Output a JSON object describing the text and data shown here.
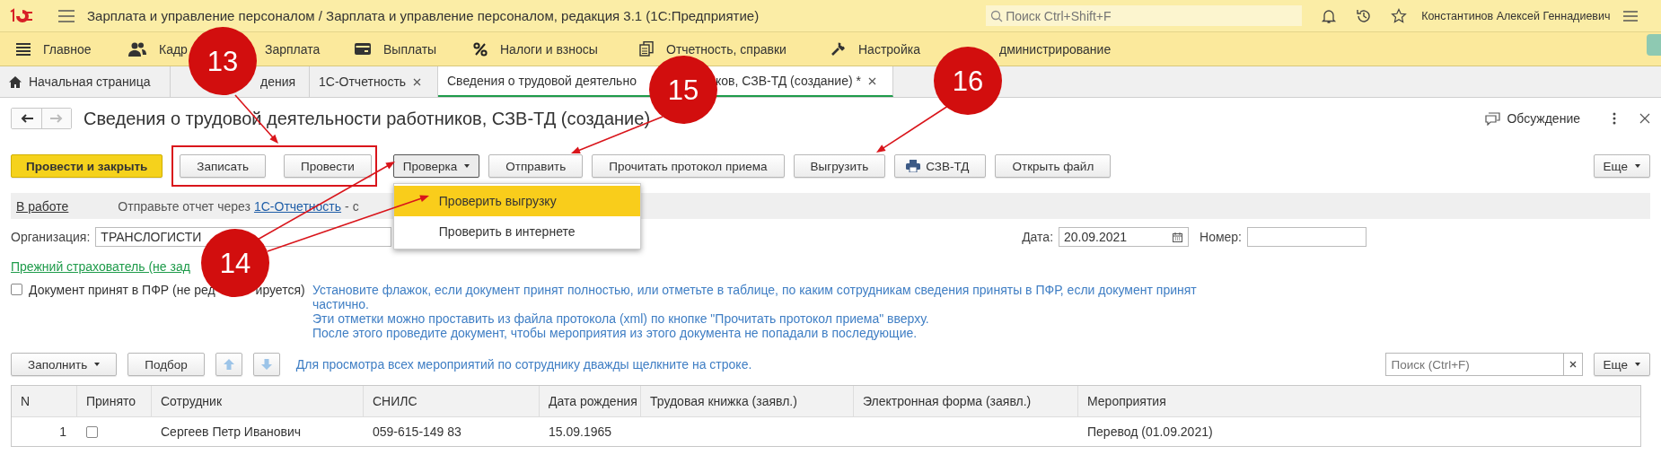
{
  "app": {
    "title": "Зарплата и управление персоналом / Зарплата и управление персоналом, редакция 3.1  (1С:Предприятие)",
    "search": {
      "placeholder": "Поиск Ctrl+Shift+F"
    },
    "user": "Константинов Алексей Геннадиевич"
  },
  "sections": [
    {
      "label": "Главное"
    },
    {
      "label": "Кадр"
    },
    {
      "label": "Зарплата"
    },
    {
      "label": "Выплаты"
    },
    {
      "label": "Налоги и взносы"
    },
    {
      "label": "Отчетность, справки"
    },
    {
      "label": "Настройка"
    },
    {
      "label": "дминистрирование"
    }
  ],
  "tabs": [
    {
      "label": "Начальная страница",
      "selected": false,
      "closable": false
    },
    {
      "label": "дения",
      "selected": false,
      "closable": false
    },
    {
      "label": "1С-Отчетность",
      "selected": false,
      "closable": true
    },
    {
      "label": "Сведения о трудовой деятельно",
      "label_tail": "ков, СЗВ-ТД (создание) *",
      "selected": true,
      "closable": true
    }
  ],
  "document": {
    "title": "Сведения о трудовой деятельности работников, СЗВ-ТД (создание)",
    "discussion": "Обсуждение"
  },
  "toolbar": [
    {
      "label": "Провести и закрыть",
      "kind": "primary"
    },
    {
      "label": "Записать",
      "kind": "framed"
    },
    {
      "label": "Провести",
      "kind": "framed"
    },
    {
      "label": "Проверка",
      "kind": "menu"
    },
    {
      "label": "Отправить",
      "kind": "plain"
    },
    {
      "label": "Прочитать протокол приема",
      "kind": "plain"
    },
    {
      "label": "Выгрузить",
      "kind": "plain"
    },
    {
      "label": "СЗВ-ТД",
      "kind": "print"
    },
    {
      "label": "Открыть файл",
      "kind": "plain"
    }
  ],
  "more": "Еще",
  "dropdown": [
    {
      "label": "Проверить выгрузку",
      "selected": true
    },
    {
      "label": "Проверить в интернете",
      "selected": false
    }
  ],
  "status": {
    "state": "В работе",
    "message": "Отправьте отчет через",
    "link": "1С-Отчетность",
    "tail": "- с"
  },
  "organization": {
    "label": "Организация:",
    "value": "ТРАНСЛОГИСТИ"
  },
  "date": {
    "label": "Дата:",
    "value": "20.09.2021"
  },
  "number": {
    "label": "Номер:"
  },
  "previous_insurer": "Прежний страхователь (не зад",
  "accepted": {
    "label": "Документ принят в ПФР (не ред",
    "label_tail": "ируется)",
    "checked": false
  },
  "hint_lines": [
    "Установите флажок, если документ принят полностью, или отметьте в таблице, по каким сотрудникам сведения приняты в ПФР, если документ принят",
    "частично.",
    "Эти отметки можно проставить из файла протокола (xml) по кнопке \"Прочитать протокол приема\" вверху.",
    "После этого проведите документ, чтобы мероприятия из этого документа не попадали в последующие."
  ],
  "table_toolbar": {
    "fill": "Заполнить",
    "pick": "Подбор",
    "hint": "Для просмотра всех мероприятий по сотруднику дважды щелкните на строке.",
    "search": {
      "placeholder": "Поиск (Ctrl+F)"
    },
    "more": "Еще"
  },
  "table": {
    "columns": [
      "N",
      "Принято",
      "Сотрудник",
      "СНИЛС",
      "Дата рождения",
      "Трудовая книжка (заявл.)",
      "Электронная форма (заявл.)",
      "Мероприятия"
    ],
    "rows": [
      {
        "n": "1",
        "accepted": false,
        "employee": "Сергеев Петр Иванович",
        "snils": "059-615-149 83",
        "birth": "15.09.1965",
        "events": "Перевод (01.09.2021)"
      }
    ]
  },
  "callouts": [
    {
      "label": "13"
    },
    {
      "label": "14"
    },
    {
      "label": "15"
    },
    {
      "label": "16"
    }
  ]
}
